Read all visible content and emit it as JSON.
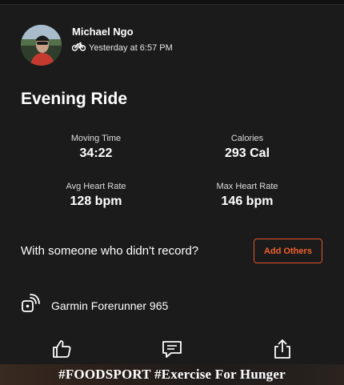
{
  "athlete": {
    "name": "Michael Ngo",
    "activity_type_icon": "bike-icon",
    "timestamp": "Yesterday at 6:57 PM"
  },
  "activity": {
    "title": "Evening Ride"
  },
  "stats": [
    {
      "label": "Moving Time",
      "value": "34:22"
    },
    {
      "label": "Calories",
      "value": "293 Cal"
    },
    {
      "label": "Avg Heart Rate",
      "value": "128 bpm"
    },
    {
      "label": "Max Heart Rate",
      "value": "146 bpm"
    }
  ],
  "group": {
    "prompt": "With someone who didn't record?",
    "add_button": "Add Others"
  },
  "device": {
    "icon": "device-sync-icon",
    "name": "Garmin Forerunner 965"
  },
  "actions": {
    "like_icon": "thumbs-up-icon",
    "comment_icon": "comment-icon",
    "share_icon": "share-icon"
  },
  "caption": "#FOODSPORT #Exercise For Hunger",
  "colors": {
    "background": "#1b1b1b",
    "accent": "#f2602e",
    "text": "#ffffff"
  }
}
